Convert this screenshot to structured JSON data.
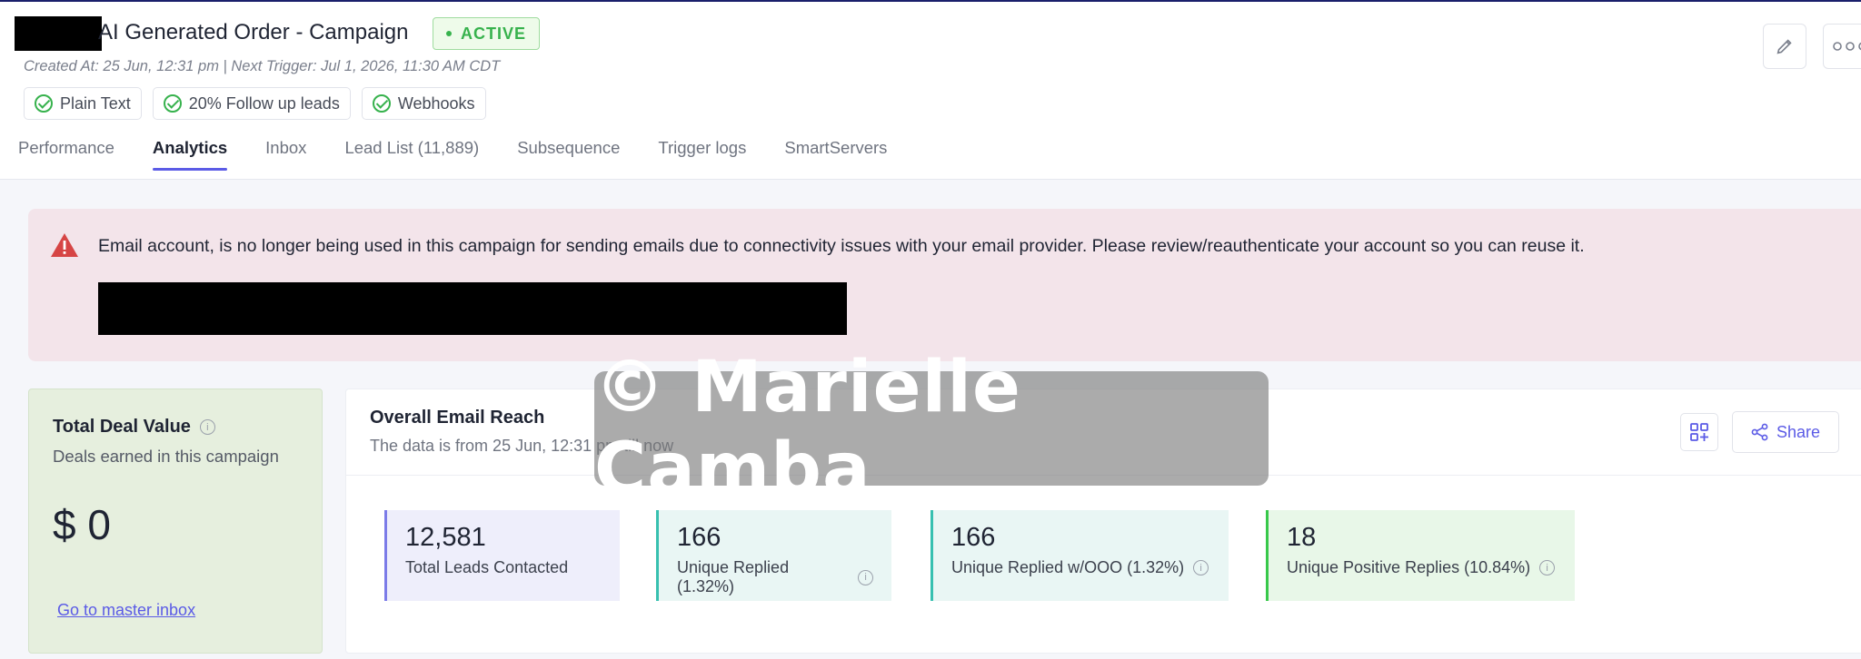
{
  "header": {
    "title": "AI Generated Order - Campaign",
    "status": "ACTIVE",
    "meta": "Created At: 25 Jun, 12:31 pm | Next Trigger: Jul 1, 2026, 11:30 AM CDT",
    "chips": [
      "Plain Text",
      "20% Follow up leads",
      "Webhooks"
    ],
    "tabs": [
      "Performance",
      "Analytics",
      "Inbox",
      "Lead List (11,889)",
      "Subsequence",
      "Trigger logs",
      "SmartServers"
    ],
    "active_tab": "Analytics",
    "icons": {
      "edit": "pencil-icon",
      "more": "more-icon"
    },
    "colors": {
      "accent": "#5b5be6",
      "status": "#37b24d"
    }
  },
  "alert": {
    "message": "Email account, is no longer being used in this campaign for sending emails due to connectivity issues with your email provider. Please review/reauthenticate your account so you can reuse it.",
    "icon": "warning-icon",
    "background": "#f3e4ea"
  },
  "deal": {
    "title": "Total Deal Value",
    "subtitle": "Deals earned in this campaign",
    "value": "$ 0",
    "link": "Go to master inbox"
  },
  "reach": {
    "title": "Overall Email Reach",
    "subtitle": "The data is from 25 Jun, 12:31 pm till now",
    "share_label": "Share",
    "stats": [
      {
        "value": "12,581",
        "label": "Total Leads Contacted"
      },
      {
        "value": "166",
        "label": "Unique Replied (1.32%)"
      },
      {
        "value": "166",
        "label": "Unique Replied w/OOO (1.32%)"
      },
      {
        "value": "18",
        "label": "Unique Positive Replies (10.84%)"
      }
    ]
  },
  "watermark": "© Marielle Camba"
}
